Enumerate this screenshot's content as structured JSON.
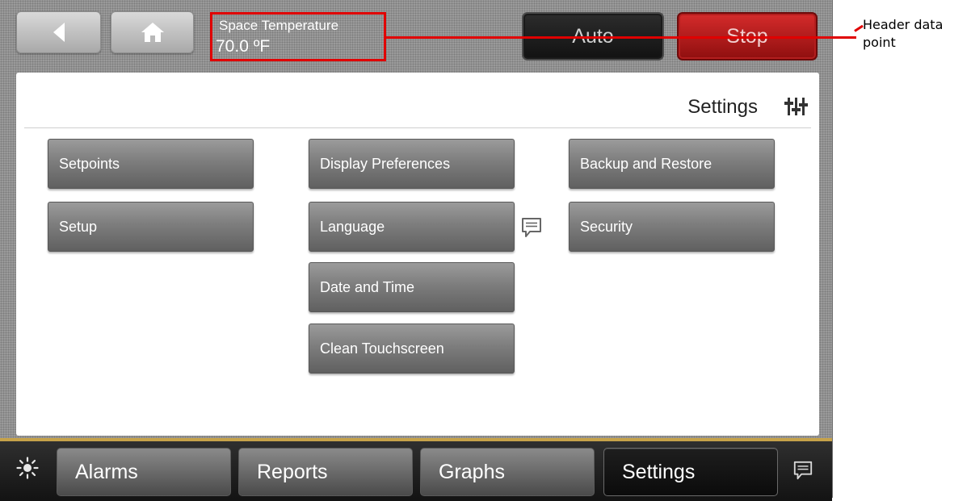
{
  "header": {
    "datapoint": {
      "label": "Space Temperature",
      "value": "70.0 ºF"
    },
    "auto_label": "Auto",
    "stop_label": "Stop",
    "back_icon": "back-arrow-icon",
    "home_icon": "home-icon"
  },
  "annotation": {
    "text": "Header data point",
    "color": "#e00000"
  },
  "panel": {
    "title": "Settings",
    "title_icon": "settings-sliders-icon",
    "buttons": [
      {
        "label": "Setpoints"
      },
      {
        "label": "Setup"
      },
      {
        "label": "Display Preferences"
      },
      {
        "label": "Language"
      },
      {
        "label": "Date and Time"
      },
      {
        "label": "Clean Touchscreen"
      },
      {
        "label": "Backup and Restore"
      },
      {
        "label": "Security"
      }
    ],
    "language_icon": "chat-bubble-icon"
  },
  "bottom": {
    "tabs": [
      {
        "label": "Alarms"
      },
      {
        "label": "Reports"
      },
      {
        "label": "Graphs"
      },
      {
        "label": "Settings",
        "active": true
      }
    ],
    "brightness_icon": "brightness-icon",
    "chat_icon": "chat-bubble-icon"
  },
  "colors": {
    "stop": "#b71c1c",
    "accent_line": "#c6a24a",
    "annotation": "#e00000"
  }
}
